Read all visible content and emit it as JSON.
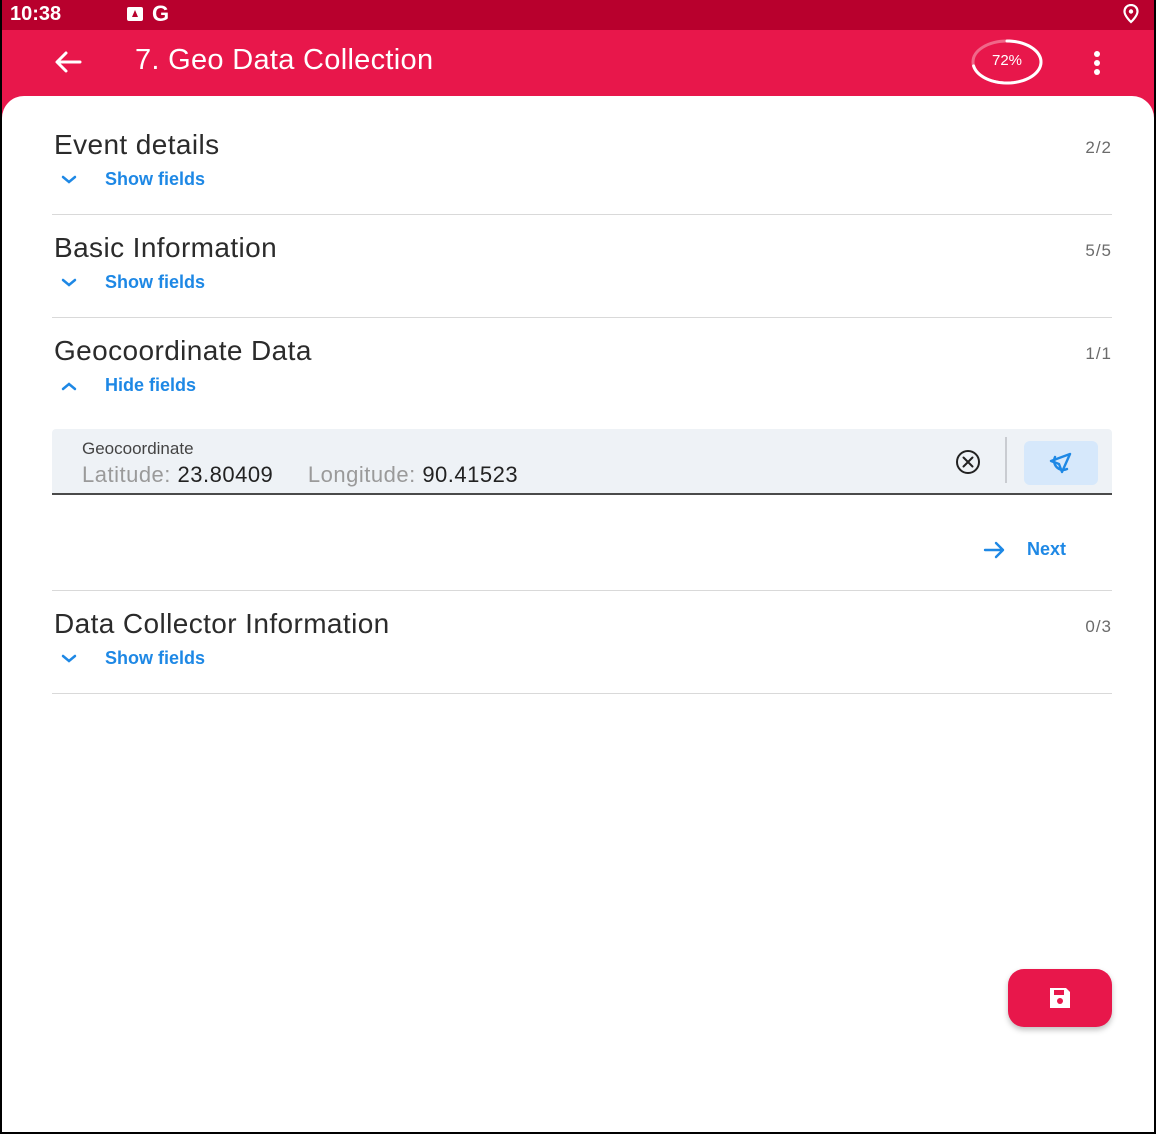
{
  "status_bar": {
    "time": "10:38",
    "icons": [
      "image-icon",
      "google-icon",
      "location-icon"
    ],
    "google_glyph": "G"
  },
  "app_bar": {
    "title": "7. Geo Data Collection",
    "progress_label": "72%",
    "progress_value": 72,
    "accent_color": "#e8174b",
    "status_bar_color": "#b8002d"
  },
  "sections": [
    {
      "title": "Event details",
      "count": "2/2",
      "toggle_label": "Show fields",
      "expanded": false
    },
    {
      "title": "Basic Information",
      "count": "5/5",
      "toggle_label": "Show fields",
      "expanded": false
    },
    {
      "title": "Geocoordinate Data",
      "count": "1/1",
      "toggle_label": "Hide fields",
      "expanded": true,
      "field": {
        "label": "Geocoordinate",
        "latitude_label": "Latitude:",
        "latitude_value": "23.80409",
        "longitude_label": "Longitude:",
        "longitude_value": "90.41523"
      },
      "next_label": "Next"
    },
    {
      "title": "Data Collector Information",
      "count": "0/3",
      "toggle_label": "Show fields",
      "expanded": false
    }
  ],
  "fab": {
    "icon": "save-icon"
  },
  "link_color": "#1e88e5"
}
